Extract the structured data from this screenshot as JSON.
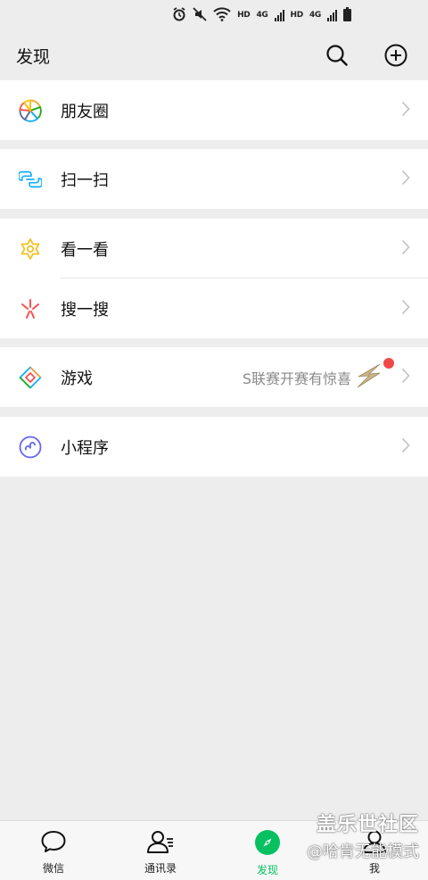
{
  "status_bar": {
    "hd1": "HD",
    "net1": "4G",
    "hd2": "HD",
    "net2": "4G"
  },
  "header": {
    "title": "发现"
  },
  "groups": [
    {
      "items": [
        {
          "label": "朋友圈",
          "icon": "moments-icon"
        }
      ]
    },
    {
      "items": [
        {
          "label": "扫一扫",
          "icon": "scan-icon"
        }
      ]
    },
    {
      "items": [
        {
          "label": "看一看",
          "icon": "top-stories-icon"
        },
        {
          "label": "搜一搜",
          "icon": "search-sparkle-icon"
        }
      ]
    },
    {
      "items": [
        {
          "label": "游戏",
          "icon": "games-icon",
          "promo": "S联赛开赛有惊喜",
          "badge": "red-dot"
        }
      ]
    },
    {
      "items": [
        {
          "label": "小程序",
          "icon": "mini-programs-icon"
        }
      ]
    }
  ],
  "tabbar": {
    "tabs": [
      {
        "label": "微信",
        "icon": "chat-bubble-icon"
      },
      {
        "label": "通讯录",
        "icon": "contacts-icon"
      },
      {
        "label": "发现",
        "icon": "compass-icon",
        "active": true
      },
      {
        "label": "我",
        "icon": "me-icon"
      }
    ],
    "active_color": "#07c160"
  },
  "watermark": {
    "line1": "盖乐世社区",
    "line2": "@哈肯无能模式"
  },
  "colors": {
    "accent": "#07c160",
    "background": "#ededed",
    "badge": "#f04848"
  }
}
